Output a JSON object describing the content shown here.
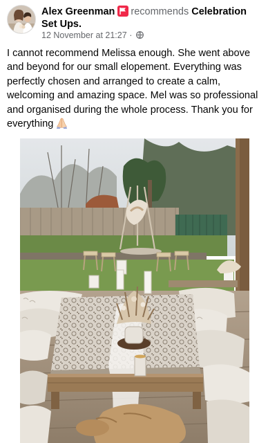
{
  "post": {
    "author": "Alex Greenman",
    "verb": "recommends",
    "page": "Celebration Set Ups.",
    "timestamp": "12 November at 21:27",
    "separator": "·",
    "body": "I cannot recommend Melissa enough. She went above and beyond for our small elopement. Everything was perfectly chosen and arranged to create a calm, welcoming and amazing space. Mel was so professional and organised during the whole process. Thank you for everything"
  },
  "icons": {
    "avatar": "avatar",
    "recommend": "recommend-flag-icon",
    "audience": "globe-icon",
    "emoji": "folded-hands-emoji-icon"
  },
  "colors": {
    "text": "#050505",
    "secondary": "#65676b",
    "recommend": "#f02849"
  }
}
